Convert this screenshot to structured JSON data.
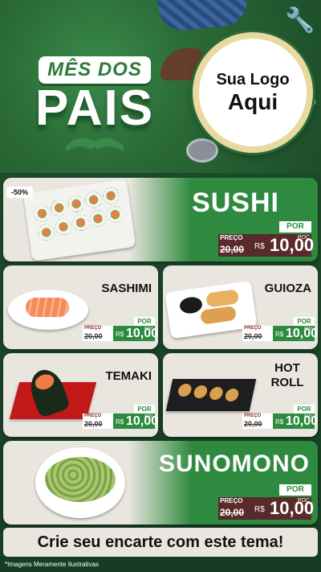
{
  "header": {
    "title_top": "MÊS DOS",
    "title_main": "PAIS",
    "logo_line1": "Sua Logo",
    "logo_line2": "Aqui"
  },
  "price_labels": {
    "por": "POR",
    "preco": "PREÇO",
    "currency": "R$",
    "poc": "POC"
  },
  "featured": [
    {
      "name": "SUSHI",
      "old_price": "20,00",
      "new_price": "10,00",
      "discount": "-50%"
    },
    {
      "name": "SUNOMONO",
      "old_price": "20,00",
      "new_price": "10,00"
    }
  ],
  "items": [
    {
      "name": "SASHIMI",
      "old_price": "20,00",
      "new_price": "10,00"
    },
    {
      "name": "GUIOZA",
      "old_price": "20,00",
      "new_price": "10,00"
    },
    {
      "name": "TEMAKI",
      "old_price": "20,00",
      "new_price": "10,00"
    },
    {
      "name": "HOT ROLL",
      "old_price": "20,00",
      "new_price": "10,00"
    }
  ],
  "footer": {
    "cta": "Crie seu encarte com este tema!",
    "disclaimer": "*Imagens Meramente Ilustrativas"
  },
  "colors": {
    "brand_green": "#2d8a3e",
    "dark_green": "#1d4a2a",
    "card_bg": "#e8e6de",
    "price_dark": "#5a2a2a"
  }
}
